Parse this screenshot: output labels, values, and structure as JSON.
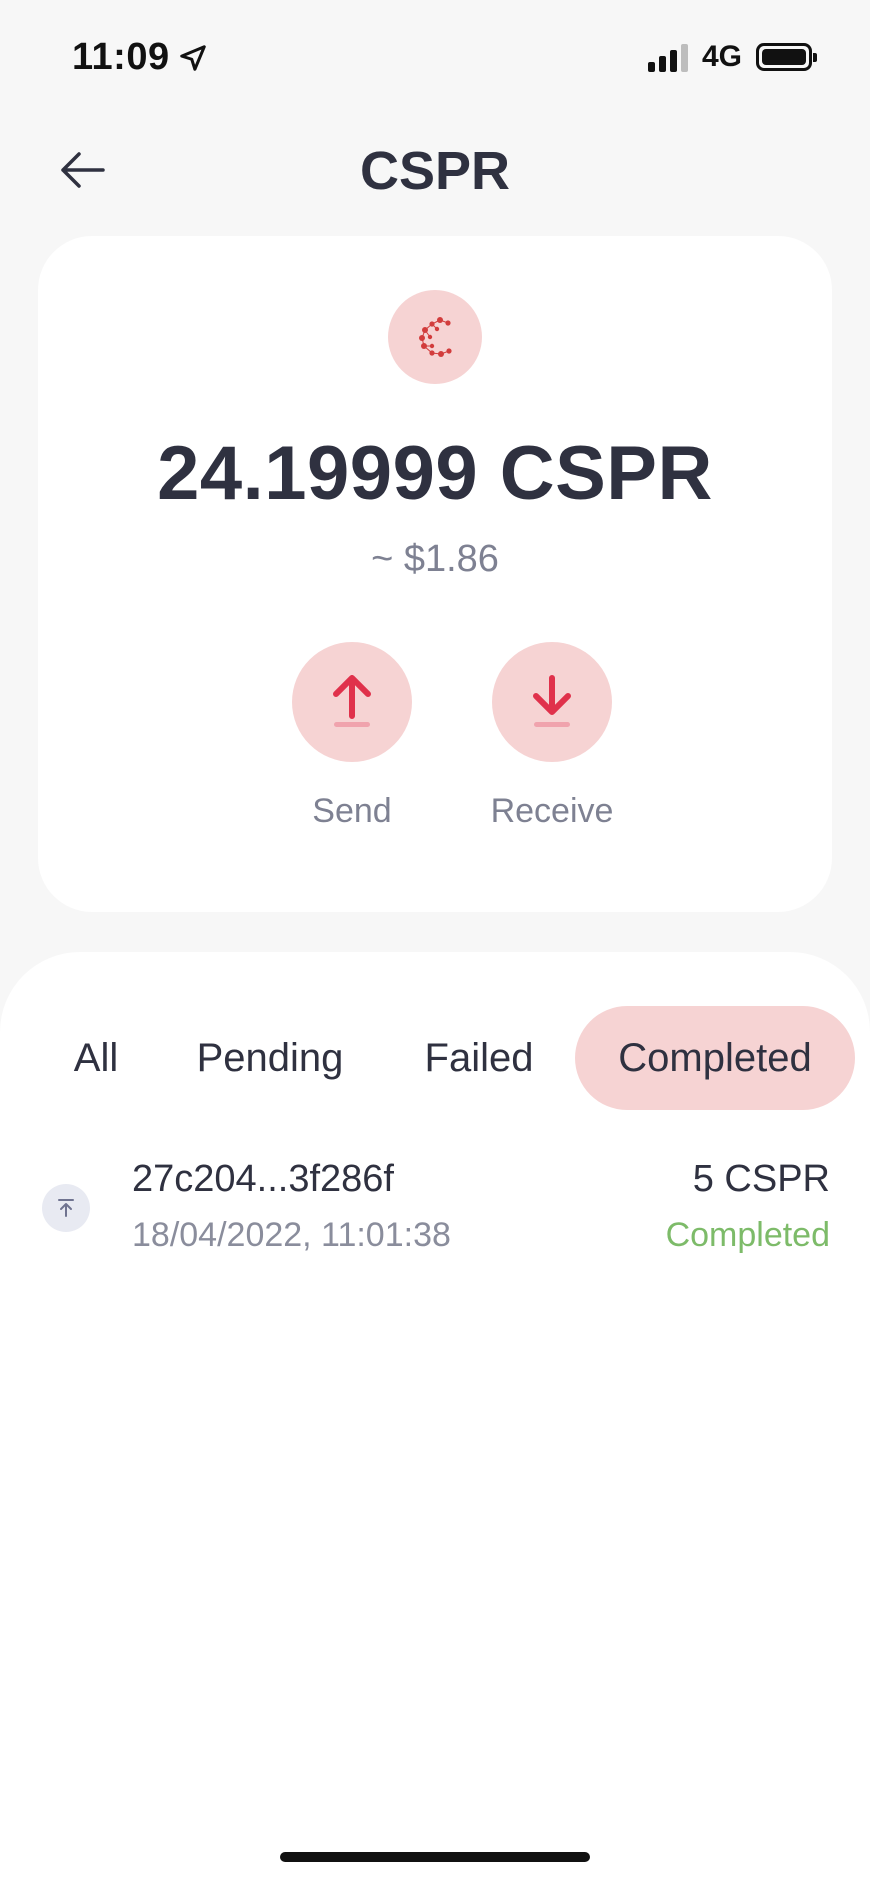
{
  "status_bar": {
    "time": "11:09",
    "network": "4G"
  },
  "header": {
    "title": "CSPR"
  },
  "balance": {
    "amount": "24.19999 CSPR",
    "fiat": "~ $1.86"
  },
  "actions": {
    "send_label": "Send",
    "receive_label": "Receive"
  },
  "tabs": [
    {
      "label": "All",
      "active": false
    },
    {
      "label": "Pending",
      "active": false
    },
    {
      "label": "Failed",
      "active": false
    },
    {
      "label": "Completed",
      "active": true
    }
  ],
  "transactions": [
    {
      "hash": "27c204...3f286f",
      "date": "18/04/2022, 11:01:38",
      "amount": "5 CSPR",
      "status": "Completed",
      "direction_icon": "arrow-up-icon"
    }
  ],
  "colors": {
    "accent": "#e0314b",
    "accent_bg": "#f6d3d3",
    "completed": "#7dbb69",
    "text_primary": "#2f3140",
    "text_secondary": "#7e8192"
  }
}
